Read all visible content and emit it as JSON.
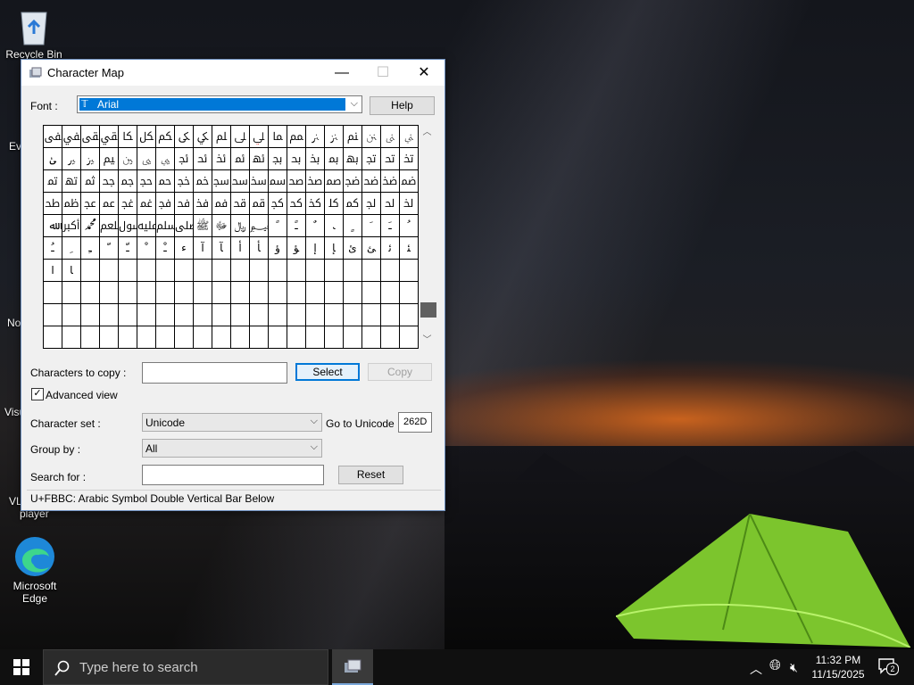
{
  "desktop": {
    "icons": [
      {
        "id": "recycle-bin",
        "label": "Recycle Bin"
      },
      {
        "id": "edge",
        "label": "Microsoft Edge"
      }
    ],
    "partial_labels": [
      "Ev",
      "No",
      "Visu",
      "VL",
      "player"
    ]
  },
  "window": {
    "title": "Character Map",
    "font_label": "Font :",
    "font_value": "Arial",
    "help_label": "Help",
    "grid_rows": [
      [
        "ﱼ",
        "ﱽ",
        "ﱾ",
        "ﱿ",
        "ﲀ",
        "ﲁ",
        "ﲂ",
        "ﲃ",
        "ﲄ",
        "ﲅ",
        "ﲆ",
        "ﲇ",
        "ﲈ",
        "ﲉ",
        "ﲊ",
        "ﲋ",
        "ﲌ",
        "ﲍ",
        "ﲎ",
        "ﲏ"
      ],
      [
        "ﲐ",
        "ﲑ",
        "ﲒ",
        "ﲓ",
        "ﲔ",
        "ﲕ",
        "ﲖ",
        "ﲗ",
        "ﲘ",
        "ﲙ",
        "ﲚ",
        "ﲛ",
        "ﲜ",
        "ﲝ",
        "ﲞ",
        "ﲟ",
        "ﲠ",
        "ﲡ",
        "ﲢ",
        "ﲣ"
      ],
      [
        "ﲤ",
        "ﲥ",
        "ﲦ",
        "ﲧ",
        "ﲨ",
        "ﲩ",
        "ﲪ",
        "ﲫ",
        "ﲬ",
        "ﲭ",
        "ﲮ",
        "ﲯ",
        "ﲰ",
        "ﲱ",
        "ﲲ",
        "ﲳ",
        "ﲴ",
        "ﲵ",
        "ﲶ",
        "ﲷ"
      ],
      [
        "ﲸ",
        "ﲹ",
        "ﲺ",
        "ﲻ",
        "ﲼ",
        "ﲽ",
        "ﲾ",
        "ﲿ",
        "ﳀ",
        "ﳁ",
        "ﳂ",
        "ﳃ",
        "ﳄ",
        "ﳅ",
        "ﳆ",
        "ﳇ",
        "ﳈ",
        "ﳉ",
        "ﳊ",
        "ﳋ"
      ],
      [
        "ﷲ",
        "ﷳ",
        "ﷴ",
        "ﷵ",
        "ﷶ",
        "ﷷ",
        "ﷸ",
        "ﷹ",
        "ﷺ",
        "ﷻ",
        "﷼",
        "﷽",
        "ﹰ",
        "ﹱ",
        "ﹲ",
        "ﹳ",
        "ﹴ",
        "ﹶ",
        "ﹷ",
        "ﹸ"
      ],
      [
        "ﹹ",
        "ﹺ",
        "ﹻ",
        "ﹼ",
        "ﹽ",
        "ﹾ",
        "ﹿ",
        "ﺀ",
        "ﺁ",
        "ﺂ",
        "ﺃ",
        "ﺄ",
        "ﺅ",
        "ﺆ",
        "ﺇ",
        "ﺈ",
        "ﺉ",
        "ﺊ",
        "ﺋ",
        "ﺌ"
      ],
      [
        "ﺍ",
        "ﺎ",
        "",
        "",
        "",
        "",
        "",
        "",
        "",
        "",
        "",
        "",
        "",
        "",
        "",
        "",
        "",
        "",
        "",
        ""
      ],
      [
        "",
        "",
        "",
        "",
        "",
        "",
        "",
        "",
        "",
        "",
        "",
        "",
        "",
        "",
        "",
        "",
        "",
        "",
        "",
        ""
      ],
      [
        "",
        "",
        "",
        "",
        "",
        "",
        "",
        "",
        "",
        "",
        "",
        "",
        "",
        "",
        "",
        "",
        "",
        "",
        "",
        ""
      ],
      [
        "",
        "",
        "",
        "",
        "",
        "",
        "",
        "",
        "",
        "",
        "",
        "",
        "",
        "",
        "",
        "",
        "",
        "",
        "",
        ""
      ]
    ],
    "chars_to_copy_label": "Characters to copy :",
    "chars_to_copy_value": "",
    "select_label": "Select",
    "copy_label": "Copy",
    "advanced_view_label": "Advanced view",
    "advanced_view_checked": true,
    "charset_label": "Character set :",
    "charset_value": "Unicode",
    "goto_unicode_label": "Go to Unicode :",
    "goto_unicode_value": "262D",
    "groupby_label": "Group by :",
    "groupby_value": "All",
    "searchfor_label": "Search for :",
    "searchfor_value": "",
    "reset_label": "Reset",
    "status": "U+FBBC: Arabic Symbol Double Vertical Bar Below"
  },
  "taskbar": {
    "search_placeholder": "Type here to search",
    "time": "11:32 PM",
    "date": "11/15/2025",
    "notification_count": "2"
  },
  "colors": {
    "accent": "#0078d7",
    "taskbar": "#101010",
    "tent": "#8bd23a"
  }
}
